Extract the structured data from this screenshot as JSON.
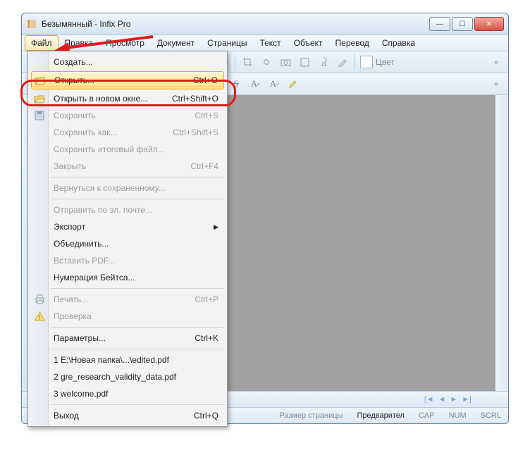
{
  "window": {
    "title": "Безымянный - Infix Pro"
  },
  "menubar": [
    "Файл",
    "Правка",
    "Просмотр",
    "Документ",
    "Страницы",
    "Текст",
    "Объект",
    "Перевод",
    "Справка"
  ],
  "toolbar_color_label": "Цвет",
  "statusbar": {
    "page_size": "Размер страницы",
    "preview": "Предварител",
    "cap": "CAP",
    "num": "NUM",
    "scrl": "SCRL"
  },
  "file_menu": {
    "items": [
      {
        "kind": "item",
        "label": "Создать...",
        "shortcut": "",
        "icon": "",
        "disabled": false
      },
      {
        "kind": "item",
        "label": "Открыть...",
        "shortcut": "Ctrl+O",
        "icon": "open",
        "highlighted": true
      },
      {
        "kind": "item",
        "label": "Открыть в новом окне...",
        "shortcut": "Ctrl+Shift+O",
        "icon": "open",
        "disabled": false
      },
      {
        "kind": "item",
        "label": "Сохранить",
        "shortcut": "Ctrl+S",
        "icon": "save",
        "disabled": true
      },
      {
        "kind": "item",
        "label": "Сохранить как...",
        "shortcut": "Ctrl+Shift+S",
        "disabled": true
      },
      {
        "kind": "item",
        "label": "Сохранить итоговый файл...",
        "disabled": true
      },
      {
        "kind": "item",
        "label": "Закрыть",
        "shortcut": "Ctrl+F4",
        "disabled": true
      },
      {
        "kind": "sep"
      },
      {
        "kind": "item",
        "label": "Вернуться к сохраненному...",
        "disabled": true
      },
      {
        "kind": "sep"
      },
      {
        "kind": "item",
        "label": "Отправить по эл. почте...",
        "disabled": true
      },
      {
        "kind": "submenu",
        "label": "Экспорт"
      },
      {
        "kind": "item",
        "label": "Объединить..."
      },
      {
        "kind": "item",
        "label": "Вставить PDF...",
        "disabled": true
      },
      {
        "kind": "item",
        "label": "Нумерация Бейтса..."
      },
      {
        "kind": "sep"
      },
      {
        "kind": "item",
        "label": "Печать...",
        "shortcut": "Ctrl+P",
        "icon": "print",
        "disabled": true
      },
      {
        "kind": "item",
        "label": "Проверка",
        "icon": "warn",
        "disabled": true
      },
      {
        "kind": "sep"
      },
      {
        "kind": "item",
        "label": "Параметры...",
        "shortcut": "Ctrl+K"
      },
      {
        "kind": "sep"
      },
      {
        "kind": "item",
        "label": "1 E:\\Новая папка\\...\\edited.pdf"
      },
      {
        "kind": "item",
        "label": "2 gre_research_validity_data.pdf"
      },
      {
        "kind": "item",
        "label": "3 welcome.pdf"
      },
      {
        "kind": "sep"
      },
      {
        "kind": "item",
        "label": "Выход",
        "shortcut": "Ctrl+Q"
      }
    ]
  }
}
